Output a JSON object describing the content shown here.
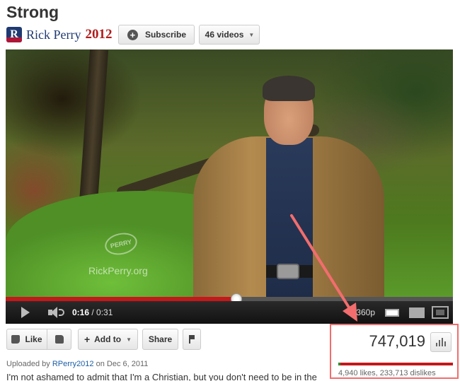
{
  "video": {
    "title": "Strong",
    "watermark_seal": "PERRY",
    "watermark_url": "RickPerry.org",
    "progress": 0.516
  },
  "channel": {
    "logo_letter": "R",
    "name": "Rick Perry",
    "year": "2012",
    "subscribe_label": "Subscribe",
    "videos_label": "46 videos"
  },
  "player": {
    "current_time": "0:16",
    "duration": "/ 0:31",
    "quality": "360p"
  },
  "actions": {
    "like_label": "Like",
    "add_to_label": "Add to",
    "share_label": "Share"
  },
  "stats": {
    "views": "747,019",
    "likes_dislikes": "4,940 likes, 233,713 dislikes",
    "like_ratio": 0.0207
  },
  "upload": {
    "prefix": "Uploaded by",
    "user": "RPerry2012",
    "date": "on Dec 6, 2011"
  },
  "description": "I'm not ashamed to admit that I'm a Christian, but you don't need to be in the",
  "colors": {
    "annotation": "#f26d6d",
    "progress": "#c4181a",
    "like_green": "#2e8b2e"
  }
}
